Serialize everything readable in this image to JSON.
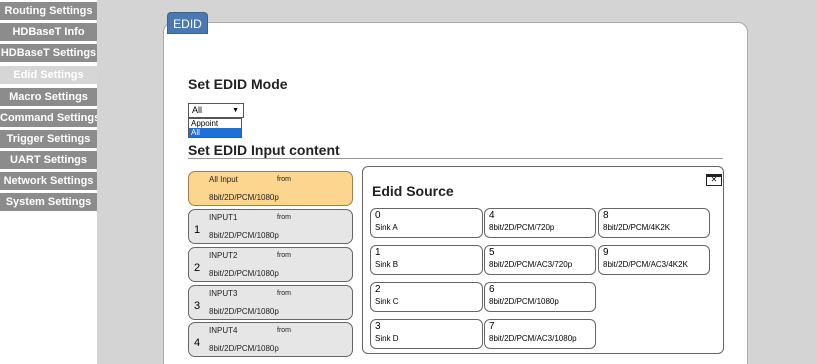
{
  "sidebar": {
    "items": [
      {
        "label": "Routing Settings",
        "active": false
      },
      {
        "label": "HDBaseT Info",
        "active": false
      },
      {
        "label": "HDBaseT Settings",
        "active": false
      },
      {
        "label": "Edid Settings",
        "active": true
      },
      {
        "label": "Macro Settings",
        "active": false
      },
      {
        "label": "Command Settings",
        "active": false
      },
      {
        "label": "Trigger Settings",
        "active": false
      },
      {
        "label": "UART Settings",
        "active": false
      },
      {
        "label": "Network Settings",
        "active": false
      },
      {
        "label": "System Settings",
        "active": false
      }
    ]
  },
  "panel": {
    "tab_label": "EDID",
    "mode_title": "Set EDID Mode",
    "mode_select": {
      "value": "All",
      "options": [
        "Appoint",
        "All"
      ],
      "highlighted": "All"
    },
    "content_title": "Set EDID Input content"
  },
  "inputs": [
    {
      "name": "All Input",
      "from": "from",
      "format": "8bit/2D/PCM/1080p",
      "number": "",
      "selected": true
    },
    {
      "name": "INPUT1",
      "from": "from",
      "format": "8bit/2D/PCM/1080p",
      "number": "1",
      "selected": false
    },
    {
      "name": "INPUT2",
      "from": "from",
      "format": "8bit/2D/PCM/1080p",
      "number": "2",
      "selected": false
    },
    {
      "name": "INPUT3",
      "from": "from",
      "format": "8bit/2D/PCM/1080p",
      "number": "3",
      "selected": false
    },
    {
      "name": "INPUT4",
      "from": "from",
      "format": "8bit/2D/PCM/1080p",
      "number": "4",
      "selected": false
    }
  ],
  "edid_source": {
    "title": "Edid Source",
    "close_icon": "close-window-icon",
    "sources": [
      {
        "id": "0",
        "label": "Sink A"
      },
      {
        "id": "1",
        "label": "Sink B"
      },
      {
        "id": "2",
        "label": "Sink C"
      },
      {
        "id": "3",
        "label": "Sink D"
      },
      {
        "id": "4",
        "label": "8bit/2D/PCM/720p"
      },
      {
        "id": "5",
        "label": "8bit/2D/PCM/AC3/720p"
      },
      {
        "id": "6",
        "label": "8bit/2D/PCM/1080p"
      },
      {
        "id": "7",
        "label": "8bit/2D/PCM/AC3/1080p"
      },
      {
        "id": "8",
        "label": "8bit/2D/PCM/4K2K"
      },
      {
        "id": "9",
        "label": "8bit/2D/PCM/AC3/4K2K"
      }
    ]
  },
  "colors": {
    "sidebar_bg": "#8c8c8c",
    "sidebar_active": "#d6d6d6",
    "tab_blue": "#4a78b0",
    "selected_input": "#fcd58e",
    "input_bg": "#e6e6e6",
    "dropdown_highlight": "#1e6fd6"
  }
}
